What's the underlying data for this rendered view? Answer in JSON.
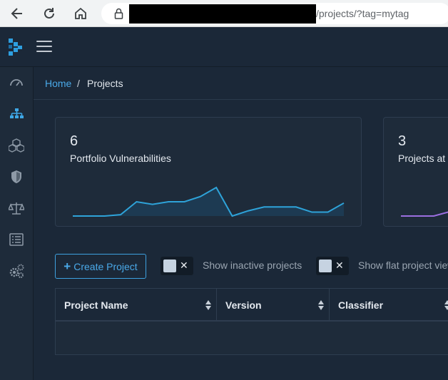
{
  "browser": {
    "url_visible": "/projects/?tag=mytag"
  },
  "breadcrumb": {
    "home": "Home",
    "separator": "/",
    "current": "Projects"
  },
  "cards": [
    {
      "value": "6",
      "label": "Portfolio Vulnerabilities"
    },
    {
      "value": "3",
      "label": "Projects at Risk"
    }
  ],
  "sparkline": {
    "color": "#2ea3d9",
    "values": [
      0,
      0,
      0,
      1,
      11,
      9,
      11,
      11,
      15,
      22,
      0,
      4,
      7,
      7,
      7,
      3,
      3,
      10
    ]
  },
  "toolbar": {
    "create_label": "Create Project",
    "toggle_x": "✕",
    "inactive_label": "Show inactive projects",
    "flat_label": "Show flat project view"
  },
  "table": {
    "columns": [
      "Project Name",
      "Version",
      "Classifier"
    ]
  },
  "colors": {
    "accent": "#4aa9e9",
    "background": "#1b2838",
    "panel": "#1e2b3a"
  }
}
